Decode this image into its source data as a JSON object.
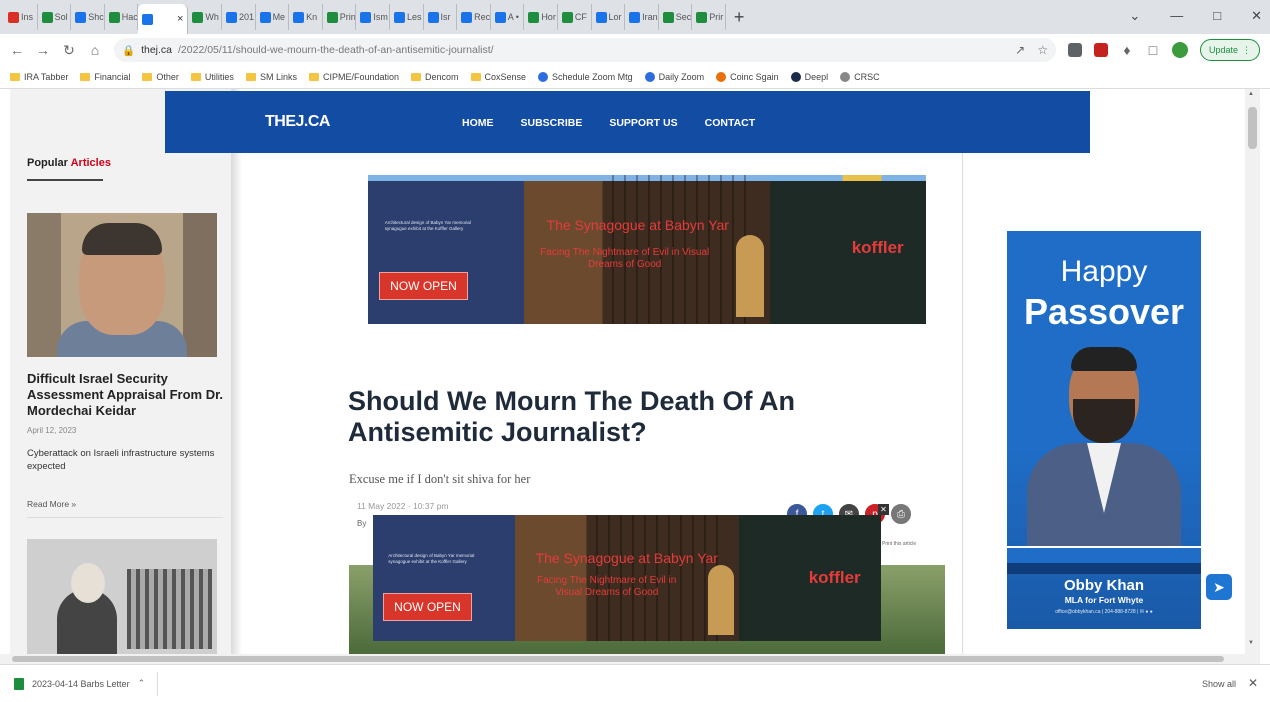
{
  "browser": {
    "tabs": [
      {
        "label": "Ins",
        "color": "#d93025"
      },
      {
        "label": "Sol",
        "color": "#1e8e3e"
      },
      {
        "label": "Shc",
        "color": "#1a73e8"
      },
      {
        "label": "Hac",
        "color": "#1e8e3e"
      },
      {
        "label": "",
        "color": "#1a73e8",
        "active": true
      },
      {
        "label": "Wh",
        "color": "#1e8e3e"
      },
      {
        "label": "201",
        "color": "#1a73e8"
      },
      {
        "label": "Me",
        "color": "#1a73e8"
      },
      {
        "label": "Kn",
        "color": "#1a73e8"
      },
      {
        "label": "Prin",
        "color": "#1e8e3e"
      },
      {
        "label": "Ism",
        "color": "#1a73e8"
      },
      {
        "label": "Les",
        "color": "#1a73e8"
      },
      {
        "label": "Isr",
        "color": "#1a73e8"
      },
      {
        "label": "Rec",
        "color": "#1a73e8"
      },
      {
        "label": "A •",
        "color": "#1a73e8"
      },
      {
        "label": "Hor",
        "color": "#1e8e3e"
      },
      {
        "label": "CF",
        "color": "#1e8e3e"
      },
      {
        "label": "Lor",
        "color": "#1a73e8"
      },
      {
        "label": "Iran",
        "color": "#1a73e8"
      },
      {
        "label": "Sec",
        "color": "#1e8e3e"
      },
      {
        "label": "Prir",
        "color": "#1e8e3e"
      }
    ],
    "new_tab": "+",
    "url_domain": "thej.ca",
    "url_path": "/2022/05/11/should-we-mourn-the-death-of-an-antisemitic-journalist/",
    "update_label": "Update",
    "bookmarks": [
      {
        "label": "IRA Tabber",
        "type": "folder"
      },
      {
        "label": "Financial",
        "type": "folder"
      },
      {
        "label": "Other",
        "type": "folder"
      },
      {
        "label": "Utilities",
        "type": "folder"
      },
      {
        "label": "SM Links",
        "type": "folder"
      },
      {
        "label": "CIPME/Foundation",
        "type": "folder"
      },
      {
        "label": "Dencom",
        "type": "folder"
      },
      {
        "label": "CoxSense",
        "type": "folder"
      },
      {
        "label": "Schedule Zoom Mtg",
        "type": "site",
        "color": "#2d6cdf"
      },
      {
        "label": "Daily Zoom",
        "type": "site",
        "color": "#2d6cdf"
      },
      {
        "label": "Coinc Sgain",
        "type": "site",
        "color": "#e8710a"
      },
      {
        "label": "Deepl",
        "type": "site",
        "color": "#1c2b4a"
      },
      {
        "label": "CRSC",
        "type": "site",
        "color": "#888888"
      }
    ]
  },
  "site": {
    "logo": "THEJ.CA",
    "nav": [
      "HOME",
      "SUBSCRIBE",
      "SUPPORT US",
      "CONTACT"
    ],
    "brand_color": "#134ca3"
  },
  "sidebar": {
    "heading_a": "Popular ",
    "heading_b": "Articles",
    "article": {
      "title": "Difficult Israel Security Assessment Appraisal From Dr. Mordechai Keidar",
      "date": "April 12, 2023",
      "excerpt": "Cyberattack on Israeli infrastructure systems expected",
      "read_more": "Read More »"
    }
  },
  "ads": {
    "headline": "The Synagogue at Babyn Yar",
    "subline": "Facing The Nightmare of Evil in Visual Dreams of Good",
    "brand": "koffler",
    "cta": "NOW OPEN",
    "fine_print": "Architectural design of Babyn Yar memorial synagogue exhibit at the Koffler Gallery"
  },
  "article": {
    "headline": "Should We Mourn The Death Of An Antisemitic Journalist?",
    "subhead": "Excuse me if I don't sit shiva for her",
    "date": "11 May 2022  ·  10:37 pm",
    "byline": "By",
    "print_link": "Print this article",
    "share_buttons": [
      {
        "icon": "facebook-icon",
        "glyph": "f",
        "color": "#3b5998"
      },
      {
        "icon": "twitter-icon",
        "glyph": "t",
        "color": "#1da1f2"
      },
      {
        "icon": "email-icon",
        "glyph": "✉",
        "color": "#444444"
      },
      {
        "icon": "pinterest-icon",
        "glyph": "p",
        "color": "#cb2027"
      },
      {
        "icon": "print-icon",
        "glyph": "⎙",
        "color": "#777777"
      }
    ]
  },
  "right_ad": {
    "line1": "Happy",
    "line2": "Passover",
    "name": "Obby Khan",
    "role": "MLA for Fort Whyte",
    "contact": "office@obbykhan.ca | 204-888-8728 | ✉ ● ●"
  },
  "downloads": {
    "file": "2023-04-14 Barbs Letter",
    "show_all": "Show all"
  }
}
